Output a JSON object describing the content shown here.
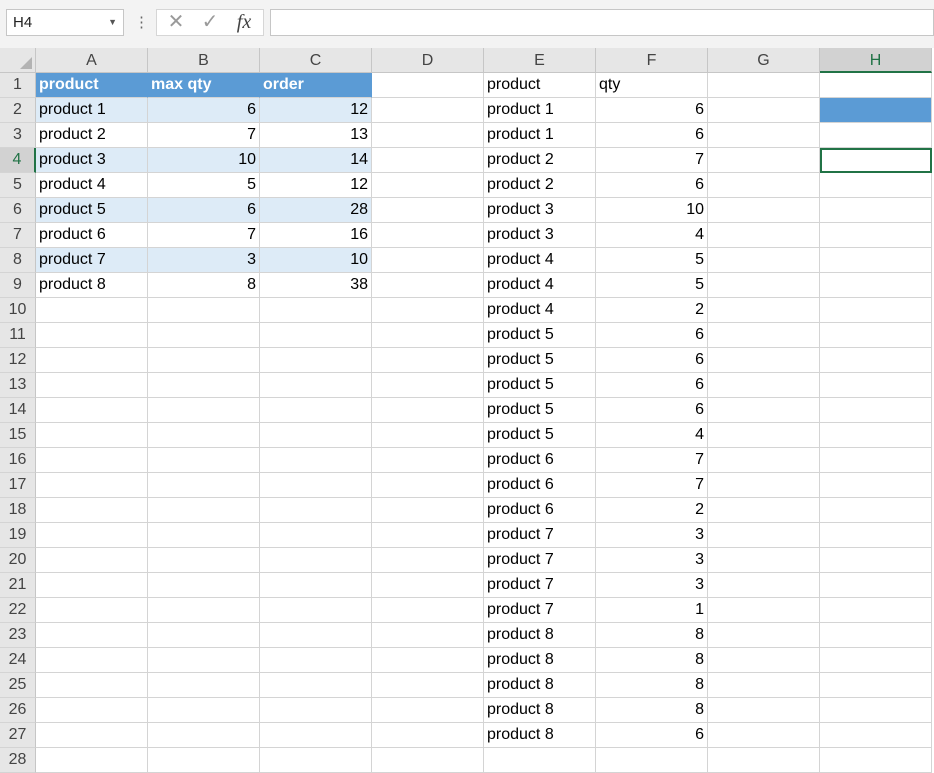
{
  "formula_bar": {
    "name_box": "H4",
    "name_box_dropdown_icon": "chevron-down-icon",
    "more_icon": "vertical-ellipsis-icon",
    "cancel_icon": "cancel-x-icon",
    "enter_icon": "check-icon",
    "function_label": "fx",
    "formula": ""
  },
  "columns": [
    "A",
    "B",
    "C",
    "D",
    "E",
    "F",
    "G",
    "H"
  ],
  "selected_column": "H",
  "selected_row": 4,
  "row_numbers": [
    1,
    2,
    3,
    4,
    5,
    6,
    7,
    8,
    9,
    10,
    11,
    12,
    13,
    14,
    15,
    16,
    17,
    18,
    19,
    20,
    21,
    22,
    23,
    24,
    25,
    26,
    27,
    28
  ],
  "colors": {
    "table_header_fill": "#5b9bd5",
    "table_band_fill": "#ddebf7",
    "selection_green": "#217346",
    "cell_h2_fill": "#5b9bd5"
  },
  "table1": {
    "headers": [
      "product",
      "max qty",
      "order"
    ],
    "rows": [
      [
        "product 1",
        "6",
        "12"
      ],
      [
        "product 2",
        "7",
        "13"
      ],
      [
        "product 3",
        "10",
        "14"
      ],
      [
        "product 4",
        "5",
        "12"
      ],
      [
        "product 5",
        "6",
        "28"
      ],
      [
        "product 6",
        "7",
        "16"
      ],
      [
        "product 7",
        "3",
        "10"
      ],
      [
        "product 8",
        "8",
        "38"
      ]
    ]
  },
  "table2": {
    "headers": [
      "product",
      "qty"
    ],
    "rows": [
      [
        "product 1",
        "6"
      ],
      [
        "product 1",
        "6"
      ],
      [
        "product 2",
        "7"
      ],
      [
        "product 2",
        "6"
      ],
      [
        "product 3",
        "10"
      ],
      [
        "product 3",
        "4"
      ],
      [
        "product 4",
        "5"
      ],
      [
        "product 4",
        "5"
      ],
      [
        "product 4",
        "2"
      ],
      [
        "product 5",
        "6"
      ],
      [
        "product 5",
        "6"
      ],
      [
        "product 5",
        "6"
      ],
      [
        "product 5",
        "6"
      ],
      [
        "product 5",
        "4"
      ],
      [
        "product 6",
        "7"
      ],
      [
        "product 6",
        "7"
      ],
      [
        "product 6",
        "2"
      ],
      [
        "product 7",
        "3"
      ],
      [
        "product 7",
        "3"
      ],
      [
        "product 7",
        "3"
      ],
      [
        "product 7",
        "1"
      ],
      [
        "product 8",
        "8"
      ],
      [
        "product 8",
        "8"
      ],
      [
        "product 8",
        "8"
      ],
      [
        "product 8",
        "8"
      ],
      [
        "product 8",
        "6"
      ]
    ]
  }
}
